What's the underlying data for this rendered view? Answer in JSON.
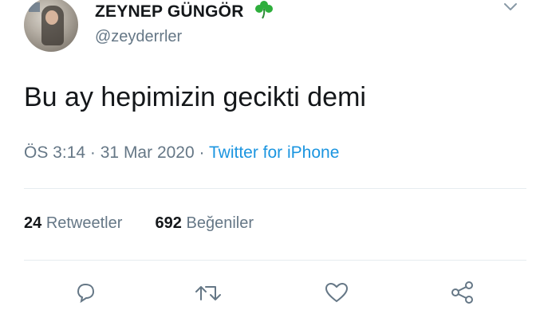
{
  "author": {
    "name": "ZEYNEP GÜNGÖR",
    "handle": "@zeyderrler",
    "emoji_icon": "shamrock-icon"
  },
  "tweet": {
    "text": "Bu ay hepimizin gecikti demi",
    "time": "ÖS 3:14",
    "separator": "·",
    "date": "31 Mar 2020",
    "source": "Twitter for iPhone"
  },
  "stats": {
    "retweets_count": "24",
    "retweets_label": "Retweetler",
    "likes_count": "692",
    "likes_label": "Beğeniler"
  },
  "colors": {
    "link": "#1b95e0",
    "secondary_text": "#657786",
    "clover": "#2eae3c"
  },
  "actions": [
    "reply-icon",
    "retweet-icon",
    "like-icon",
    "share-icon"
  ]
}
